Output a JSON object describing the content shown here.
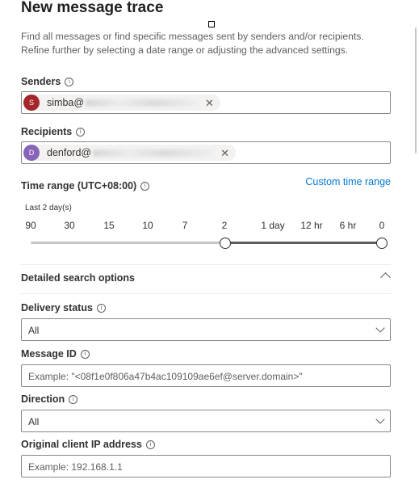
{
  "panel": {
    "title": "New message trace",
    "description": "Find all messages or find specific messages sent by senders and/or recipients. Refine further by selecting a date range or adjusting the advanced settings."
  },
  "senders": {
    "label": "Senders",
    "chip": {
      "initial": "S",
      "name": "simba@",
      "avatar_color": "#a4262c"
    }
  },
  "recipients": {
    "label": "Recipients",
    "chip": {
      "initial": "D",
      "name": "denford@",
      "avatar_color": "#8764b8"
    }
  },
  "time_range": {
    "label": "Time range (UTC+08:00)",
    "custom_link": "Custom time range",
    "caption": "Last 2 day(s)",
    "ticks": [
      "90",
      "30",
      "15",
      "10",
      "7",
      "2",
      "1 day",
      "12 hr",
      "6 hr",
      "0"
    ],
    "selected_start": "2",
    "selected_end": "0",
    "accent_color": "#605e5c"
  },
  "advanced": {
    "title": "Detailed search options",
    "expanded": true,
    "delivery_status": {
      "label": "Delivery status",
      "value": "All"
    },
    "message_id": {
      "label": "Message ID",
      "placeholder": "Example: \"<08f1e0f806a47b4ac109109ae6ef@server.domain>\""
    },
    "direction": {
      "label": "Direction",
      "value": "All"
    },
    "client_ip": {
      "label": "Original client IP address",
      "placeholder": "Example: 192.168.1.1"
    }
  }
}
